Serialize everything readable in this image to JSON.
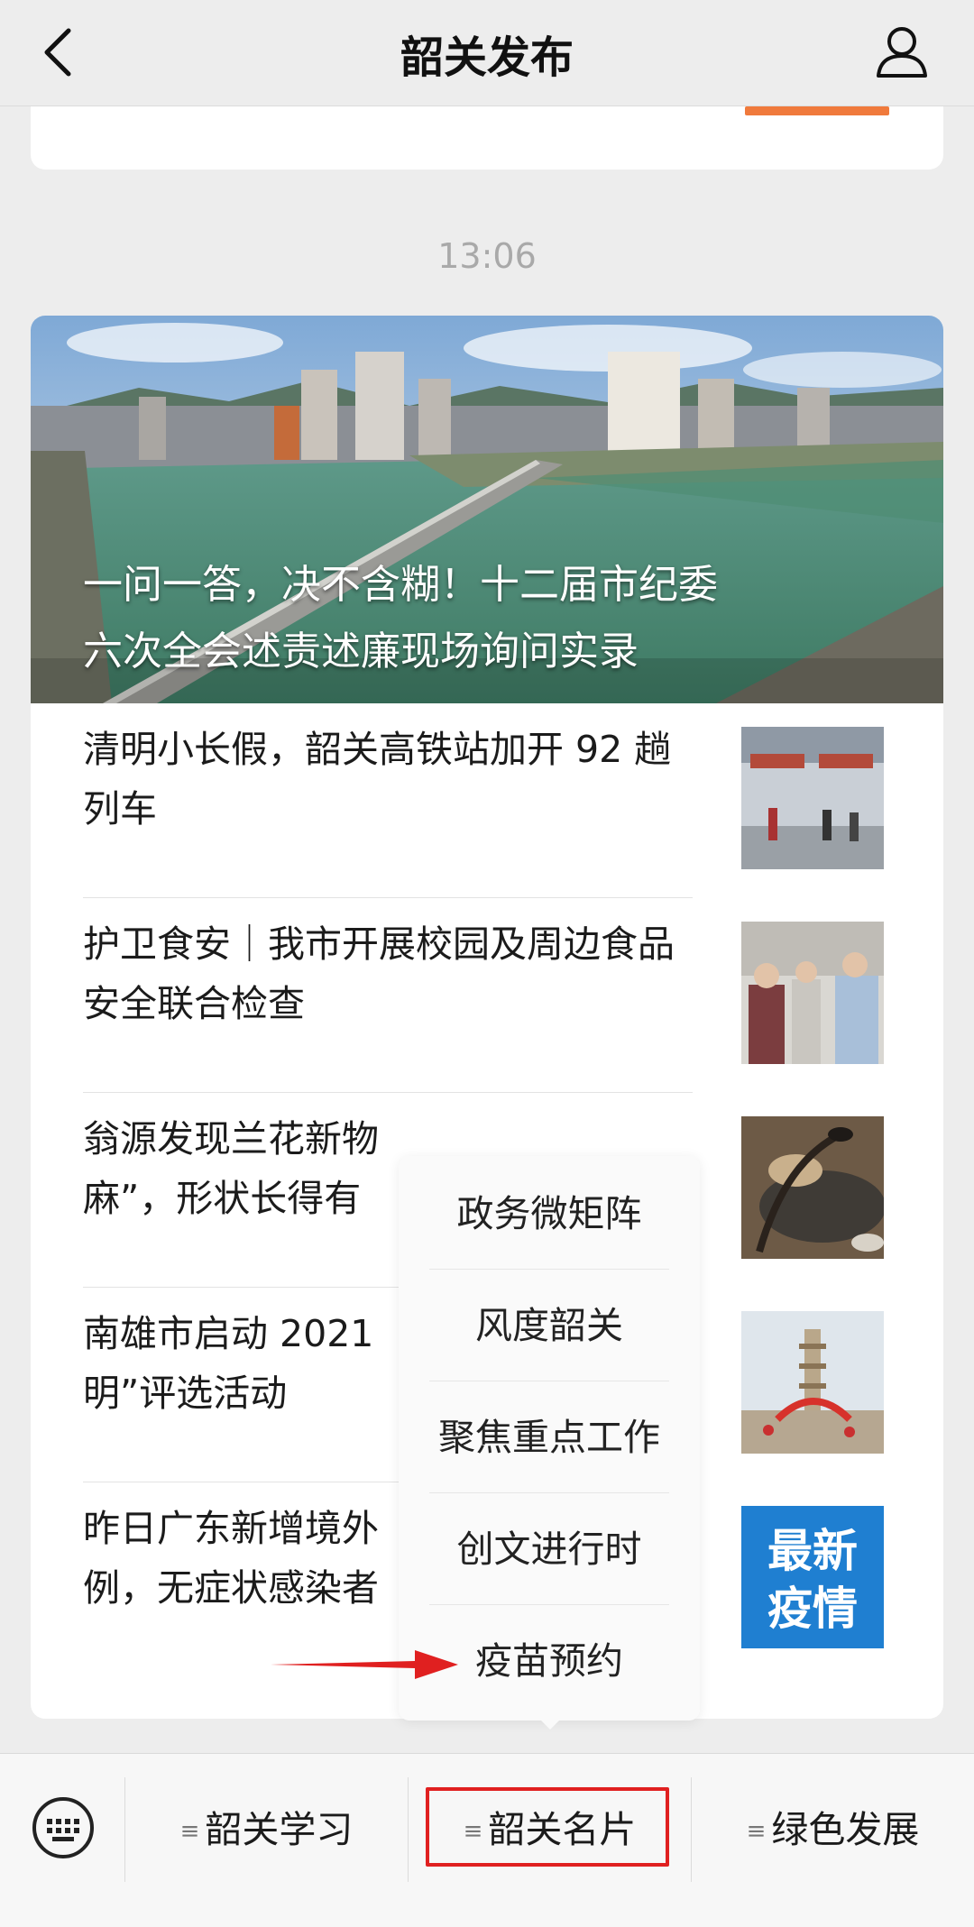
{
  "header": {
    "title": "韶关发布"
  },
  "timestamp": "13:06",
  "cover": {
    "title_line1": "一问一答，决不含糊！十二届市纪委",
    "title_line2": "六次全会述责述廉现场询问实录"
  },
  "news_items": [
    {
      "title": "清明小长假，韶关高铁站加开 92 趟列车"
    },
    {
      "title": "护卫食安｜我市开展校园及周边食品安全联合检查"
    },
    {
      "title_line1": "翁源发现兰花新物",
      "title_line2": "麻”，形状长得有"
    },
    {
      "title_line1": "南雄市启动 2021",
      "title_line2": "明”评选活动"
    },
    {
      "title_line1": "昨日广东新增境外",
      "title_line2": "例，无症状感染者"
    }
  ],
  "thumb_badge": {
    "line1": "最新",
    "line2": "疫情"
  },
  "popup_menu": [
    {
      "label": "政务微矩阵"
    },
    {
      "label": "风度韶关"
    },
    {
      "label": "聚焦重点工作"
    },
    {
      "label": "创文进行时"
    },
    {
      "label": "疫苗预约"
    }
  ],
  "bottom_menu": {
    "lines_icon": "≡",
    "items": [
      {
        "label": "韶关学习"
      },
      {
        "label": "韶关名片"
      },
      {
        "label": "绿色发展"
      }
    ]
  },
  "colors": {
    "background": "#ededed",
    "highlight_red": "#e02020",
    "badge_blue": "#1f7fd1"
  }
}
